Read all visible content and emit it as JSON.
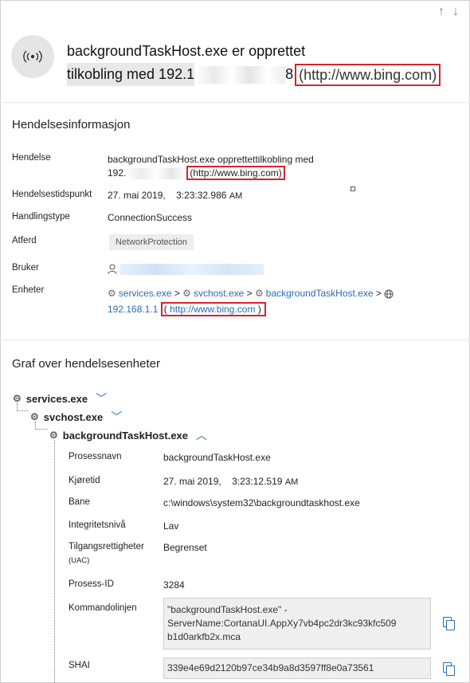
{
  "header": {
    "title_line1": "backgroundTaskHost.exe er opprettet",
    "title_line2_prefix": "tilkobling med 192.1",
    "title_line2_suffix": "8",
    "title_url": "(http://www.bing.com)",
    "icon": "broadcast-icon"
  },
  "nav": {
    "up": "↑",
    "down": "↓"
  },
  "event_info": {
    "section_title": "Hendelsesinformasjon",
    "hendelse_label": "Hendelse",
    "hendelse_line1": "backgroundTaskHost.exe opprettettilkobling med",
    "hendelse_line2_prefix": "192.",
    "hendelse_url": "(http://www.bing.com)",
    "tidspunkt_label": "Hendelsestidspunkt",
    "tidspunkt_date": "27. mai 2019,",
    "tidspunkt_time": "3:23:32.986",
    "tidspunkt_ampm": "AM",
    "handlingstype_label": "Handlingstype",
    "handlingstype_value": "ConnectionSuccess",
    "atferd_label": "Atferd",
    "atferd_value": "NetworkProtection",
    "bruker_label": "Bruker",
    "enheter_label": "Enheter",
    "enheter_services": "services.exe",
    "enheter_svchost": "svchost.exe",
    "enheter_bth": "backgroundTaskHost.exe",
    "enheter_sep": ">",
    "enheter_ip": "192.168.1.1",
    "enheter_url_open": "(",
    "enheter_url": "http://www.bing.com",
    "enheter_url_close": ")"
  },
  "graph": {
    "section_title": "Graf over hendelsesenheter",
    "node1": "services.exe",
    "node2": "svchost.exe",
    "node3": "backgroundTaskHost.exe",
    "chev_down": "﹀",
    "chev_up": "︿"
  },
  "process": {
    "prosessnavn_label": "Prosessnavn",
    "prosessnavn_value": "backgroundTaskHost.exe",
    "kjoretid_label": "Kjøretid",
    "kjoretid_date": "27. mai 2019,",
    "kjoretid_time": "3:23:12.519",
    "kjoretid_ampm": "AM",
    "bane_label": "Bane",
    "bane_value": "c:\\windows\\system32\\backgroundtaskhost.exe",
    "integritet_label": "Integritetsnivå",
    "integritet_value": "Lav",
    "tilgang_label": "Tilgangsrettigheter",
    "tilgang_sub": "(UAC)",
    "tilgang_value": "Begrenset",
    "prosessid_label": "Prosess-ID",
    "prosessid_value": "3284",
    "kommando_label": "Kommandolinjen",
    "kommando_line1": "\"backgroundTaskHost.exe\" -",
    "kommando_line2": "ServerName:CortanaUI.AppXy7vb4pc2dr3kc93kfc509",
    "kommando_line3": "b1d0arkfb2x.mca",
    "sha1_label": "SHAI",
    "sha1_value": "339e4e69d2120b97ce34b9a8d3597ff8e0a73561"
  }
}
